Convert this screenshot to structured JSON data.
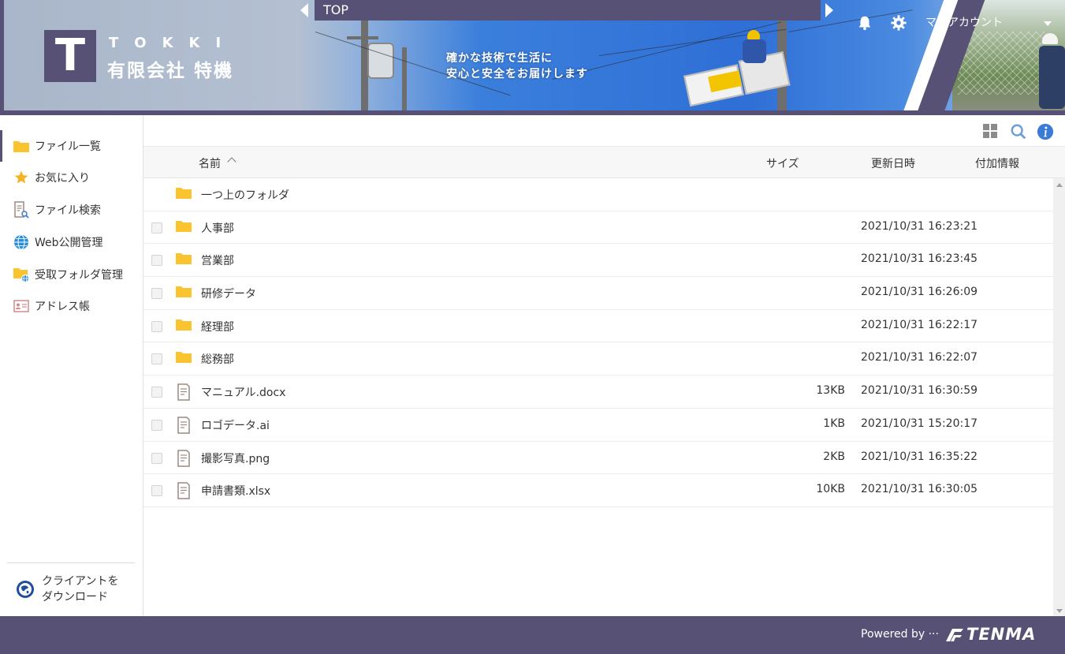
{
  "header": {
    "logo_letter": "T",
    "logo_en": "TOKKI",
    "logo_jp": "有限会社 特機",
    "slogan_line1": "確かな技術で生活に",
    "slogan_line2": "安心と安全をお届けします",
    "breadcrumb": "TOP",
    "account_label": "マイアカウント",
    "icons": [
      "bell-icon",
      "gear-icon",
      "chevron-down-icon"
    ]
  },
  "sidebar": {
    "items": [
      {
        "label": "ファイル一覧",
        "icon": "folder-icon"
      },
      {
        "label": "お気に入り",
        "icon": "star-icon"
      },
      {
        "label": "ファイル検索",
        "icon": "file-search-icon"
      },
      {
        "label": "Web公開管理",
        "icon": "globe-icon"
      },
      {
        "label": "受取フォルダ管理",
        "icon": "folder-globe-icon"
      },
      {
        "label": "アドレス帳",
        "icon": "address-card-icon"
      }
    ],
    "download_line1": "クライアントを",
    "download_line2": "ダウンロード"
  },
  "toolbar": {
    "icons": [
      "grid-view-icon",
      "search-icon",
      "info-icon"
    ]
  },
  "table": {
    "columns": {
      "name": "名前",
      "size": "サイズ",
      "updated": "更新日時",
      "extra": "付加情報"
    },
    "parent_folder": "一つ上のフォルダ",
    "rows": [
      {
        "type": "folder",
        "name": "人事部",
        "size": "",
        "updated": "2021/10/31 16:23:21"
      },
      {
        "type": "folder",
        "name": "営業部",
        "size": "",
        "updated": "2021/10/31 16:23:45"
      },
      {
        "type": "folder",
        "name": "研修データ",
        "size": "",
        "updated": "2021/10/31 16:26:09"
      },
      {
        "type": "folder",
        "name": "経理部",
        "size": "",
        "updated": "2021/10/31 16:22:17"
      },
      {
        "type": "folder",
        "name": "総務部",
        "size": "",
        "updated": "2021/10/31 16:22:07"
      },
      {
        "type": "file",
        "name": "マニュアル.docx",
        "size": "13KB",
        "updated": "2021/10/31 16:30:59"
      },
      {
        "type": "file",
        "name": "ロゴデータ.ai",
        "size": "1KB",
        "updated": "2021/10/31 15:20:17"
      },
      {
        "type": "file",
        "name": "撮影写真.png",
        "size": "2KB",
        "updated": "2021/10/31 16:35:22"
      },
      {
        "type": "file",
        "name": "申請書類.xlsx",
        "size": "10KB",
        "updated": "2021/10/31 16:30:05"
      }
    ]
  },
  "footer": {
    "powered_by": "Powered by ···",
    "brand": "TENMA"
  },
  "colors": {
    "brand_purple": "#575176",
    "folder_yellow": "#f9c430",
    "info_blue": "#3a7bd5"
  }
}
